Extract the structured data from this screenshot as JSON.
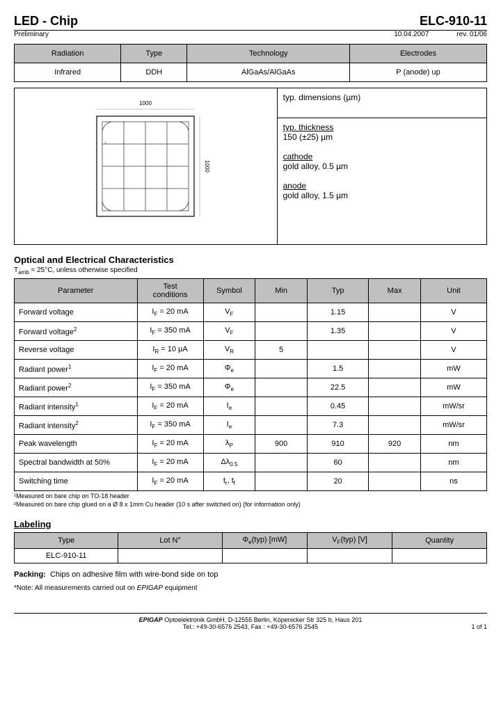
{
  "header": {
    "title": "LED - Chip",
    "part": "ELC-910-11",
    "status": "Preliminary",
    "date": "10.04.2007",
    "rev": "rev. 01/06"
  },
  "info": {
    "headers": [
      "Radiation",
      "Type",
      "Technology",
      "Electrodes"
    ],
    "values": [
      "Infrared",
      "DDH",
      "AlGaAs/AlGaAs",
      "P (anode) up"
    ]
  },
  "dimensions": {
    "title": "typ. dimensions (µm)",
    "thickness_lbl": "typ. thickness",
    "thickness_val": "150 (±25) µm",
    "cathode_lbl": "cathode",
    "cathode_val": "gold alloy, 0.5 µm",
    "anode_lbl": "anode",
    "anode_val": "gold alloy, 1.5 µm",
    "dim_top": "1000",
    "dim_side": "1000"
  },
  "characteristics": {
    "title": "Optical and Electrical Characteristics",
    "condition_note": "Tamb = 25°C, unless otherwise specified",
    "headers": [
      "Parameter",
      "Test conditions",
      "Symbol",
      "Min",
      "Typ",
      "Max",
      "Unit"
    ],
    "rows": [
      {
        "param": "Forward voltage",
        "cond": "IF = 20 mA",
        "sym": "VF",
        "min": "",
        "typ": "1.15",
        "max": "",
        "unit": "V"
      },
      {
        "param": "Forward voltage²",
        "cond": "IF = 350 mA",
        "sym": "VF",
        "min": "",
        "typ": "1.35",
        "max": "",
        "unit": "V"
      },
      {
        "param": "Reverse voltage",
        "cond": "IR = 10 µA",
        "sym": "VR",
        "min": "5",
        "typ": "",
        "max": "",
        "unit": "V"
      },
      {
        "param": "Radiant power¹",
        "cond": "IF = 20 mA",
        "sym": "Φe",
        "min": "",
        "typ": "1.5",
        "max": "",
        "unit": "mW"
      },
      {
        "param": "Radiant power²",
        "cond": "IF = 350 mA",
        "sym": "Φe",
        "min": "",
        "typ": "22.5",
        "max": "",
        "unit": "mW"
      },
      {
        "param": "Radiant intensity¹",
        "cond": "IF = 20 mA",
        "sym": "Ie",
        "min": "",
        "typ": "0.45",
        "max": "",
        "unit": "mW/sr"
      },
      {
        "param": "Radiant  intensity²",
        "cond": "IF = 350 mA",
        "sym": "Ie",
        "min": "",
        "typ": "7.3",
        "max": "",
        "unit": "mW/sr"
      },
      {
        "param": "Peak wavelength",
        "cond": "IF = 20 mA",
        "sym": "λP",
        "min": "900",
        "typ": "910",
        "max": "920",
        "unit": "nm"
      },
      {
        "param": "Spectral bandwidth at 50%",
        "cond": "IF = 20 mA",
        "sym": "Δλ0.5",
        "min": "",
        "typ": "60",
        "max": "",
        "unit": "nm"
      },
      {
        "param": "Switching time",
        "cond": "IF = 20 mA",
        "sym": "tr, tf",
        "min": "",
        "typ": "20",
        "max": "",
        "unit": "ns"
      }
    ],
    "footnote1": "¹Measured on bare chip on TO-18 header",
    "footnote2": "²Measured on bare chip glued on a Ø 8 x 1mm Cu header (10 s after switched on) (for information only)"
  },
  "labeling": {
    "title": "Labeling",
    "headers": [
      "Type",
      "Lot N°",
      "Φe(typ) [mW]",
      "VF(typ) [V]",
      "Quantity"
    ],
    "row": [
      "ELC-910-11",
      "",
      "",
      "",
      ""
    ]
  },
  "packing": {
    "label": "Packing:",
    "text": "Chips on adhesive film with wire-bond side on top"
  },
  "note": "*Note: All measurements carried out on EPIGAP equipment",
  "footer": {
    "line1": "EPIGAP Optoelektronik GmbH, D-12555 Berlin, Köpenicker Str 325 b, Haus 201",
    "line2": "Tel.: +49-30-6576 2543, Fax : +49-30-6576 2545",
    "page": "1 of  1"
  },
  "chart_data": {
    "type": "table",
    "title": "Optical and Electrical Characteristics",
    "columns": [
      "Parameter",
      "Test conditions",
      "Symbol",
      "Min",
      "Typ",
      "Max",
      "Unit"
    ],
    "rows": [
      [
        "Forward voltage",
        "IF = 20 mA",
        "VF",
        null,
        1.15,
        null,
        "V"
      ],
      [
        "Forward voltage",
        "IF = 350 mA",
        "VF",
        null,
        1.35,
        null,
        "V"
      ],
      [
        "Reverse voltage",
        "IR = 10 µA",
        "VR",
        5,
        null,
        null,
        "V"
      ],
      [
        "Radiant power",
        "IF = 20 mA",
        "Φe",
        null,
        1.5,
        null,
        "mW"
      ],
      [
        "Radiant power",
        "IF = 350 mA",
        "Φe",
        null,
        22.5,
        null,
        "mW"
      ],
      [
        "Radiant intensity",
        "IF = 20 mA",
        "Ie",
        null,
        0.45,
        null,
        "mW/sr"
      ],
      [
        "Radiant intensity",
        "IF = 350 mA",
        "Ie",
        null,
        7.3,
        null,
        "mW/sr"
      ],
      [
        "Peak wavelength",
        "IF = 20 mA",
        "λP",
        900,
        910,
        920,
        "nm"
      ],
      [
        "Spectral bandwidth at 50%",
        "IF = 20 mA",
        "Δλ0.5",
        null,
        60,
        null,
        "nm"
      ],
      [
        "Switching time",
        "IF = 20 mA",
        "tr, tf",
        null,
        20,
        null,
        "ns"
      ]
    ]
  }
}
